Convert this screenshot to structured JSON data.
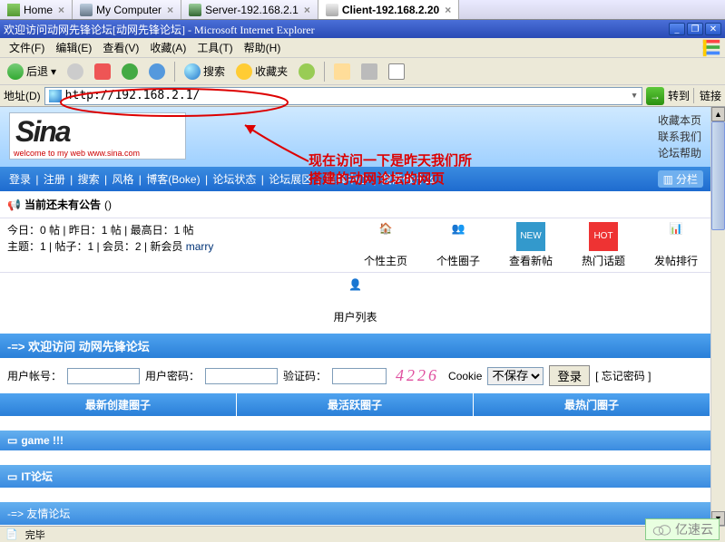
{
  "top_tabs": [
    {
      "label": "Home",
      "icon": "home-icon"
    },
    {
      "label": "My Computer",
      "icon": "computer-icon"
    },
    {
      "label": "Server-192.168.2.1",
      "icon": "server-icon"
    },
    {
      "label": "Client-192.168.2.20",
      "icon": "client-icon",
      "active": true
    }
  ],
  "ie_title": "欢迎访问动网先锋论坛[动网先锋论坛] - Microsoft Internet Explorer",
  "menu": {
    "file": "文件(F)",
    "edit": "编辑(E)",
    "view": "查看(V)",
    "favorites": "收藏(A)",
    "tools": "工具(T)",
    "help": "帮助(H)"
  },
  "toolbar": {
    "back": "后退",
    "search": "搜索",
    "favorites": "收藏夹"
  },
  "address": {
    "label": "地址(D)",
    "value": "http://192.168.2.1/",
    "go": "转到",
    "links": "链接"
  },
  "logo": {
    "text": "Sina",
    "sub": "welcome to my web www.sina.com"
  },
  "right_links": [
    "收藏本页",
    "联系我们",
    "论坛帮助"
  ],
  "nav": {
    "items": [
      "登录",
      "注册",
      "搜索",
      "风格",
      "博客(Boke)",
      "论坛状态",
      "论坛展区",
      "道具中心",
      "我能做什么"
    ],
    "split": "分栏"
  },
  "announce": {
    "text": "当前还未有公告",
    "paren": "()"
  },
  "stats": {
    "line1": "今日：0 帖 | 昨日：1 帖 | 最高日：1 帖",
    "line2_pre": "主题：1 | 帖子：1 | 会员：2 | 新会员 ",
    "new_member": "marry"
  },
  "quick_icons": [
    {
      "label": "个性主页",
      "name": "home-page"
    },
    {
      "label": "个性圈子",
      "name": "circle"
    },
    {
      "label": "查看新帖",
      "name": "new-posts"
    },
    {
      "label": "热门话题",
      "name": "hot-topics"
    },
    {
      "label": "发帖排行",
      "name": "post-rank"
    }
  ],
  "userlist": "用户列表",
  "welcome_bar": "-=> 欢迎访问 动网先锋论坛",
  "login": {
    "user_label": "用户帐号：",
    "pass_label": "用户密码：",
    "code_label": "验证码：",
    "captcha": "4226",
    "cookie_label": "Cookie",
    "cookie_value": "不保存",
    "login_btn": "登录",
    "forgot": "[ 忘记密码 ]"
  },
  "tri_headers": [
    "最新创建圈子",
    "最活跃圈子",
    "最热门圈子"
  ],
  "sections": [
    {
      "label": "game !!!"
    },
    {
      "label": "IT论坛"
    },
    {
      "label": "-=> 友情论坛"
    }
  ],
  "annotation": {
    "line1": "现在访问一下是昨天我们所",
    "line2": "搭建的动网论坛的网页"
  },
  "status": {
    "done": "完毕",
    "zone": "Inter"
  },
  "watermark": "亿速云"
}
